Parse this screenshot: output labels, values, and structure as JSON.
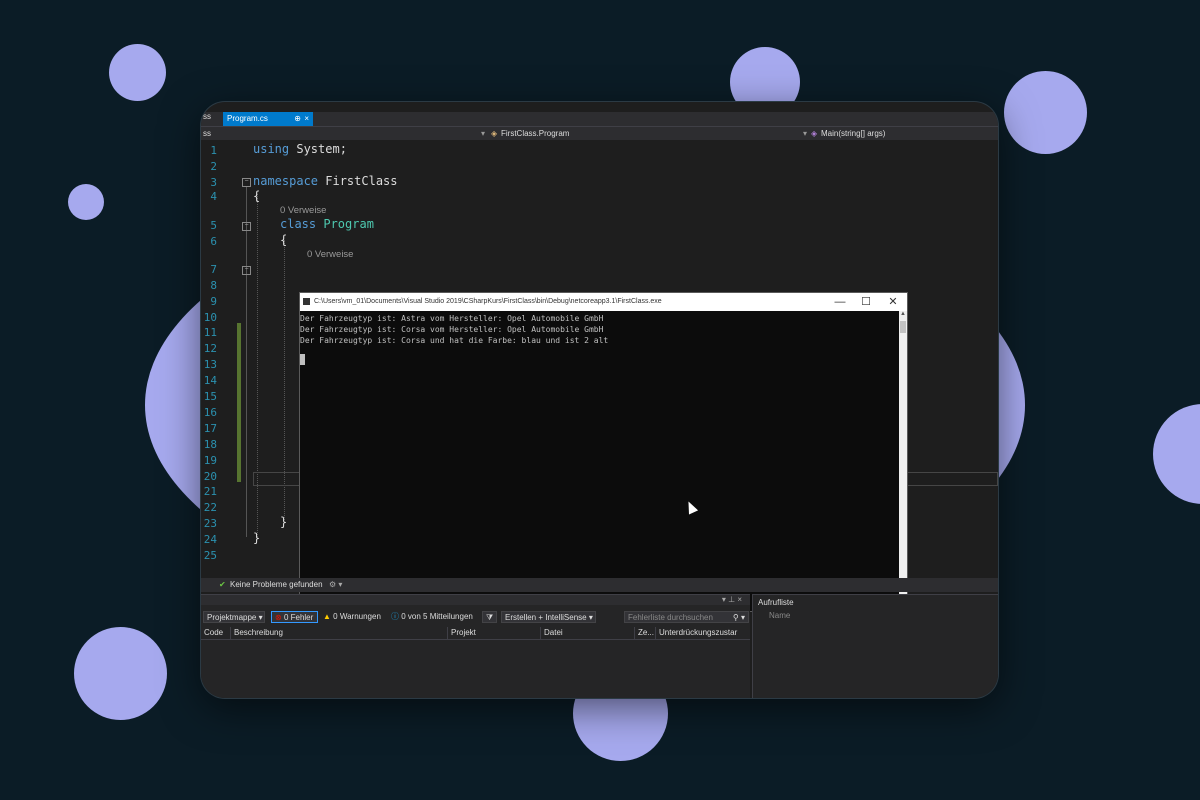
{
  "editor": {
    "tab": {
      "label": "Program.cs",
      "pin": "⊕",
      "close": "×"
    },
    "nav": {
      "left": "ss",
      "middle": "FirstClass.Program",
      "right": "Main(string[] args)"
    },
    "line_numbers": [
      "1",
      "2",
      "3",
      "4",
      "5",
      "6",
      "7",
      "8",
      "9",
      "10",
      "11",
      "12",
      "13",
      "14",
      "15",
      "16",
      "17",
      "18",
      "19",
      "20",
      "21",
      "22",
      "23",
      "24",
      "25"
    ],
    "code": {
      "l1_kw": "using",
      "l1_rest": " System;",
      "l3_kw": "namespace",
      "l3_rest": " FirstClass",
      "brace_open": "{",
      "brace_close": "}",
      "refs": "0 Verweise",
      "l5_kw": "class",
      "l5_cls": "Program",
      "refs2": "0 Verweise"
    }
  },
  "console": {
    "title": "C:\\Users\\vm_01\\Documents\\Visual Studio 2019\\CSharpKurs\\FirstClass\\bin\\Debug\\netcoreapp3.1\\FirstClass.exe",
    "minimize": "—",
    "maximize": "☐",
    "close": "✕",
    "lines": [
      "Der Fahrzeugtyp ist: Astra vom Hersteller: Opel Automobile GmbH",
      "Der Fahrzeugtyp ist: Corsa vom Hersteller: Opel Automobile GmbH",
      "Der Fahrzeugtyp ist: Corsa und hat die Farbe: blau und ist 2 alt"
    ]
  },
  "status": {
    "problems": "Keine Probleme gefunden"
  },
  "errorlist": {
    "scope": "Projektmappe",
    "errors": "0 Fehler",
    "warnings": "0 Warnungen",
    "messages": "0 von 5 Mitteilungen",
    "build": "Erstellen + IntelliSense",
    "search_placeholder": "Fehlerliste durchsuchen",
    "columns": [
      "Code",
      "Beschreibung",
      "Projekt",
      "Datei",
      "Ze...",
      "Unterdrückungszustar"
    ]
  },
  "callstack": {
    "title": "Aufrufliste",
    "column": "Name"
  },
  "colors": {
    "background": "#0b1c26",
    "bubble": "#a6a9ee",
    "accent": "#007acc"
  }
}
